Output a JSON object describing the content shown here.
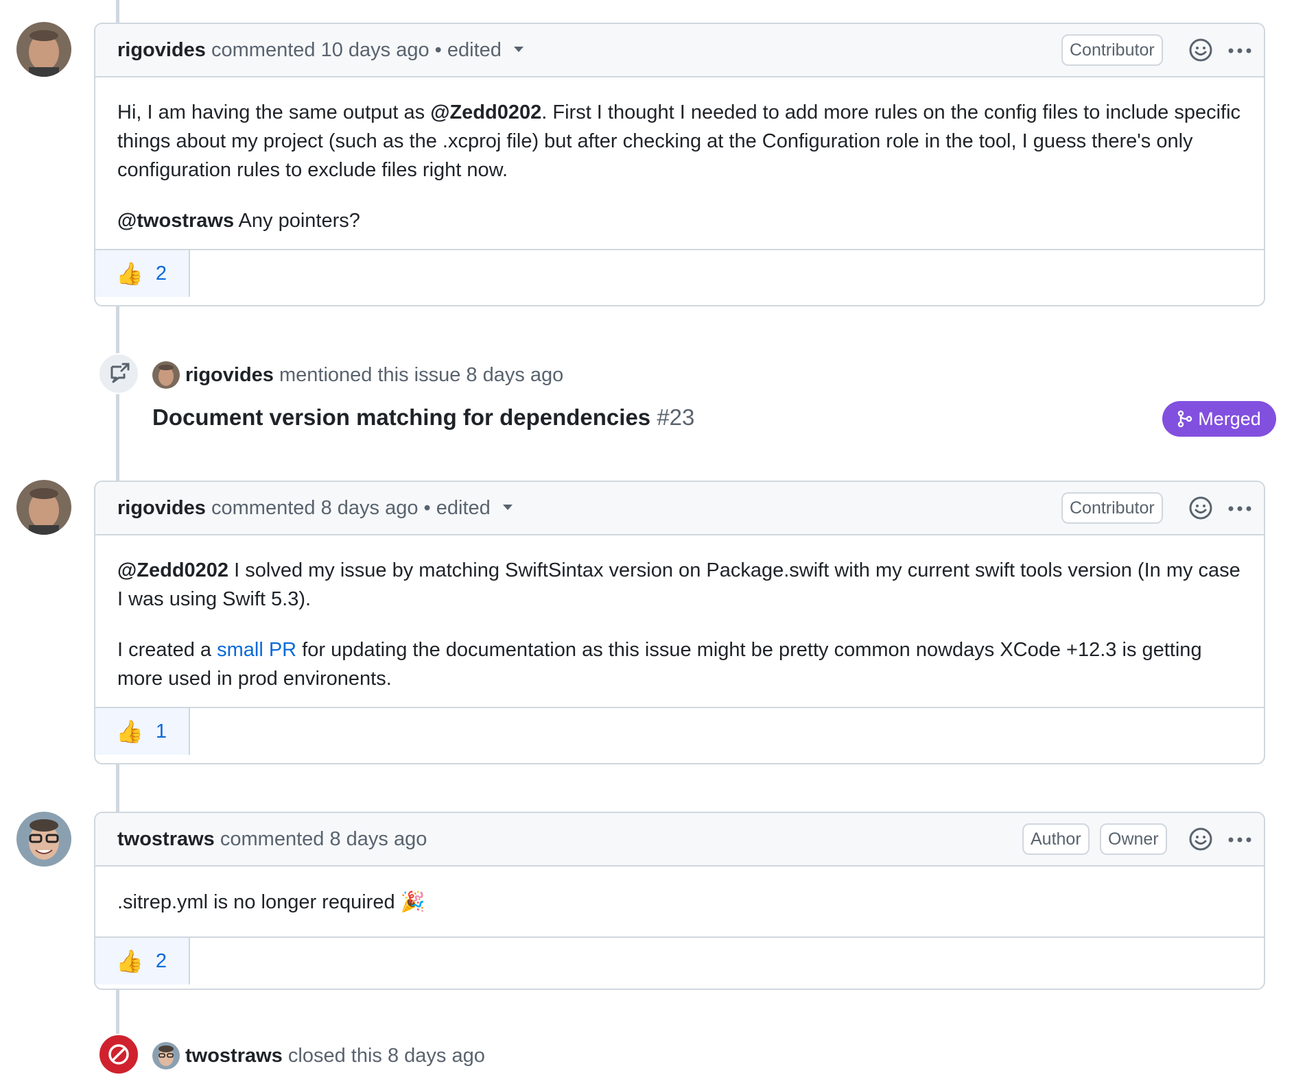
{
  "comments": [
    {
      "author": "rigovides",
      "meta": "commented 10 days ago",
      "edited": "edited",
      "badges": [
        "Contributor"
      ],
      "body": {
        "p1_mention_prefix": "Hi, I am having the same output as ",
        "p1_mention": "@Zedd0202",
        "p1_text": ". First I thought I needed to add more rules on the config files to include specific things about my project (such as the .xcproj file) but after checking at the Configuration role in the tool, I guess there's only configuration rules to exclude files right now.",
        "p2_mention": "@twostraws",
        "p2_text": " Any pointers?"
      },
      "reaction": {
        "emoji": "👍",
        "count": "2"
      }
    },
    {
      "author": "rigovides",
      "meta": "commented 8 days ago",
      "edited": "edited",
      "badges": [
        "Contributor"
      ],
      "body": {
        "p1_mention": "@Zedd0202",
        "p1_text": " I solved my issue by matching SwiftSintax version on Package.swift with my current swift tools version (In my case I was using Swift 5.3).",
        "p2_prefix": "I created a ",
        "p2_link": "small PR",
        "p2_text": " for updating the documentation as this issue might be pretty common nowdays XCode +12.3 is getting more used in prod environents."
      },
      "reaction": {
        "emoji": "👍",
        "count": "1"
      }
    },
    {
      "author": "twostraws",
      "meta": "commented 8 days ago",
      "badges": [
        "Author",
        "Owner"
      ],
      "body": {
        "p1_text": ".sitrep.yml is no longer required",
        "p1_emoji": "🎉"
      },
      "reaction": {
        "emoji": "👍",
        "count": "2"
      }
    }
  ],
  "mention_event": {
    "author": "rigovides",
    "text": "mentioned this issue 8 days ago",
    "ref_title": "Document version matching for dependencies",
    "ref_number": "#23",
    "status": "Merged"
  },
  "close_event": {
    "author": "twostraws",
    "text": "closed this 8 days ago"
  },
  "icons": {
    "smile": "smiley-icon",
    "kebab": "kebab-horizontal-icon",
    "caret": "triangle-down-icon",
    "cross_ref": "cross-reference-icon",
    "merged": "git-merge-icon",
    "closed": "skip-icon"
  },
  "colors": {
    "merged": "#8250df",
    "closed": "#cf222e",
    "link": "#0969da",
    "border": "#d0d7de",
    "header_bg": "#f6f8fa",
    "reaction_bg": "#f1f6ff"
  }
}
